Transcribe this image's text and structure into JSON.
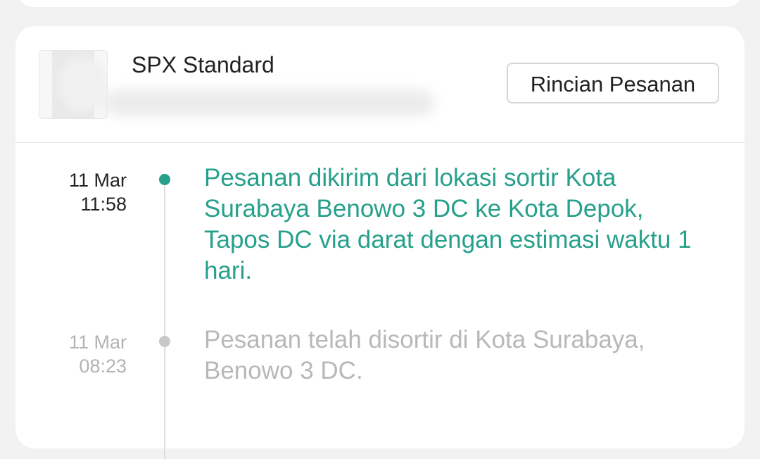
{
  "order": {
    "shipping_method": "SPX Standard",
    "detail_button_label": "Rincian Pesanan"
  },
  "tracking": {
    "events": [
      {
        "date": "11 Mar",
        "time": "11:58",
        "description": "Pesanan dikirim dari lokasi sortir Kota Surabaya  Benowo 3 DC ke Kota Depok, Tapos DC via darat dengan estimasi waktu 1 hari.",
        "status": "current"
      },
      {
        "date": "11 Mar",
        "time": "08:23",
        "description": "Pesanan telah disortir di Kota Surabaya, Benowo 3 DC.",
        "status": "past"
      }
    ]
  },
  "colors": {
    "accent": "#26a08b",
    "muted_text": "#b8b8b8",
    "background": "#f2f2f2",
    "card": "#ffffff"
  },
  "icons": {
    "timeline_current": "timeline-dot-current-icon",
    "timeline_past": "timeline-dot-past-icon"
  }
}
